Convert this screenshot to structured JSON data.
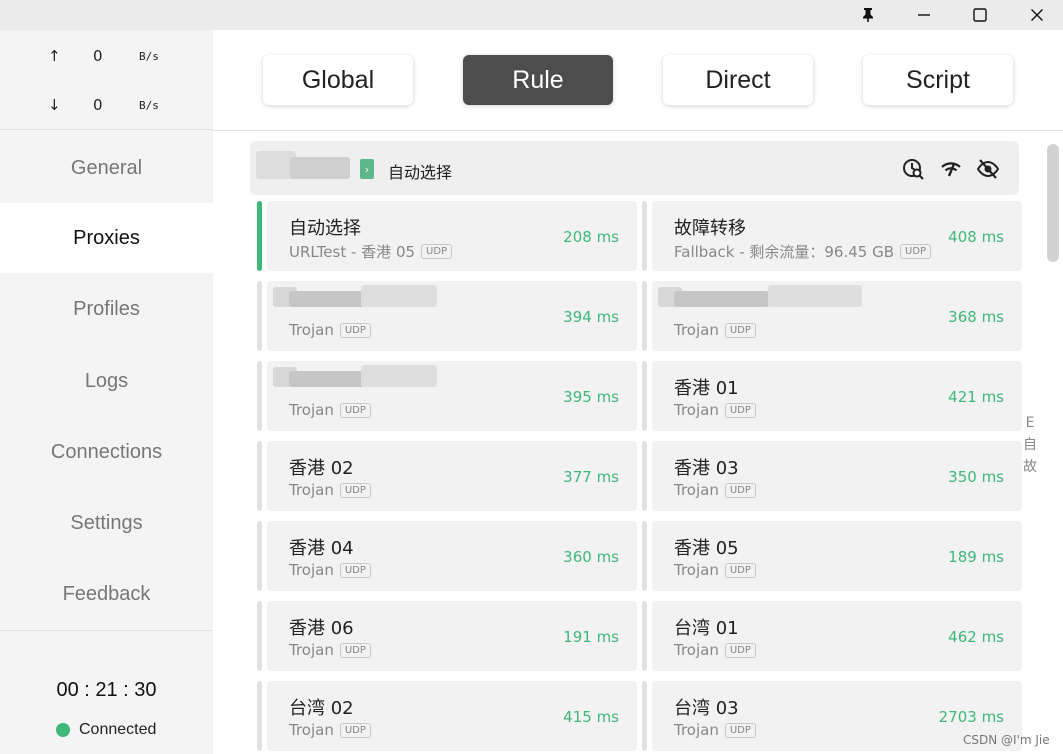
{
  "titlebar": {
    "pin_icon": "pin-icon",
    "minimize_icon": "minimize-icon",
    "maximize_icon": "maximize-icon",
    "close_icon": "close-icon"
  },
  "traffic": {
    "up": {
      "arrow": "↑",
      "value": "0",
      "unit": "B/s"
    },
    "down": {
      "arrow": "↓",
      "value": "0",
      "unit": "B/s"
    }
  },
  "nav": {
    "items": [
      "General",
      "Proxies",
      "Profiles",
      "Logs",
      "Connections",
      "Settings",
      "Feedback"
    ],
    "active": "Proxies"
  },
  "status": {
    "timer": "00 : 21 : 30",
    "state": "Connected",
    "color": "#3fb77a"
  },
  "modes": {
    "items": [
      "Global",
      "Rule",
      "Direct",
      "Script"
    ],
    "active": "Rule"
  },
  "group": {
    "selected": "自动选择",
    "icons": [
      "latency-test-icon",
      "wifi-icon",
      "hide-icon"
    ]
  },
  "proxies": [
    {
      "name": "自动选择",
      "type": "URLTest - 香港 05",
      "udp": "UDP",
      "delay": "208 ms",
      "selected": true
    },
    {
      "name": "故障转移",
      "type": "Fallback - 剩余流量：96.45 GB",
      "udp": "UDP",
      "delay": "408 ms"
    },
    {
      "name": "",
      "type": "Trojan",
      "udp": "UDP",
      "delay": "394 ms",
      "blurred": true
    },
    {
      "name": "",
      "type": "Trojan",
      "udp": "UDP",
      "delay": "368 ms",
      "blurred": true
    },
    {
      "name": "",
      "type": "Trojan",
      "udp": "UDP",
      "delay": "395 ms",
      "blurred": true
    },
    {
      "name": "香港 01",
      "type": "Trojan",
      "udp": "UDP",
      "delay": "421 ms"
    },
    {
      "name": "香港 02",
      "type": "Trojan",
      "udp": "UDP",
      "delay": "377 ms"
    },
    {
      "name": "香港 03",
      "type": "Trojan",
      "udp": "UDP",
      "delay": "350 ms"
    },
    {
      "name": "香港 04",
      "type": "Trojan",
      "udp": "UDP",
      "delay": "360 ms"
    },
    {
      "name": "香港 05",
      "type": "Trojan",
      "udp": "UDP",
      "delay": "189 ms"
    },
    {
      "name": "香港 06",
      "type": "Trojan",
      "udp": "UDP",
      "delay": "191 ms"
    },
    {
      "name": "台湾 01",
      "type": "Trojan",
      "udp": "UDP",
      "delay": "462 ms"
    },
    {
      "name": "台湾 02",
      "type": "Trojan",
      "udp": "UDP",
      "delay": "415 ms"
    },
    {
      "name": "台湾 03",
      "type": "Trojan",
      "udp": "UDP",
      "delay": "2703 ms"
    }
  ],
  "side_letters": [
    "E",
    "自",
    "故"
  ],
  "watermark": "CSDN @I'm Jie"
}
